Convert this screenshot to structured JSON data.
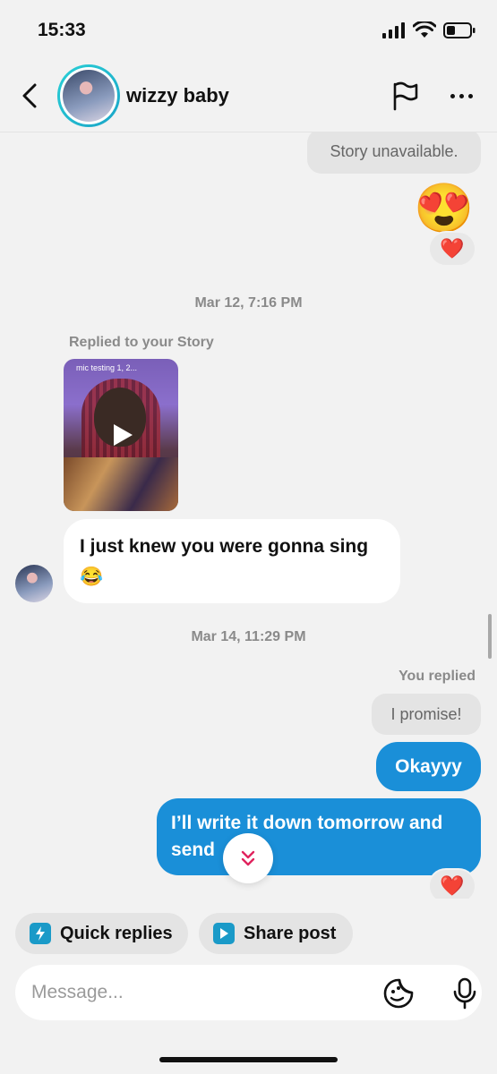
{
  "status_bar": {
    "time": "15:33"
  },
  "header": {
    "contact_name": "wizzy baby"
  },
  "messages": {
    "story_unavailable": "Story unavailable.",
    "emoji_message": "😍",
    "reaction_1": "❤️",
    "timestamp_1": "Mar 12, 7:16 PM",
    "replied_label": "Replied to your Story",
    "story_caption": "mic testing 1, 2...",
    "incoming_text": "I just knew you were gonna sing 😂",
    "timestamp_2": "Mar 14, 11:29 PM",
    "you_replied_label": "You replied",
    "quoted_reply": "I promise!",
    "outgoing_1": "Okayyy",
    "outgoing_2": "I’ll write it down tomorrow and send",
    "reaction_2": "❤️"
  },
  "quick_actions": {
    "quick_replies": "Quick replies",
    "share_post": "Share post"
  },
  "composer": {
    "placeholder": "Message..."
  },
  "colors": {
    "accent_blue": "#1a8fd8",
    "ring": "#2ad0d6",
    "chip_icon": "#1a9ac8"
  }
}
